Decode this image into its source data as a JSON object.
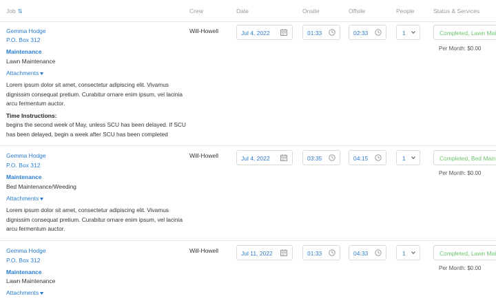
{
  "columns": {
    "job": "Job",
    "crew": "Crew",
    "date": "Date",
    "onsite": "Onsite",
    "offsite": "Offsite",
    "people": "People",
    "status": "Status & Services"
  },
  "icons": {
    "sort": "sort-icon",
    "calendar": "calendar-icon",
    "clock": "clock-icon",
    "chevron": "chevron-down-icon"
  },
  "rows": [
    {
      "customer": "Gemma Hodge",
      "address": "P.O. Box 312",
      "category": "Maintenance",
      "service": "Lawn Maintenance",
      "attachments": "Attachments",
      "description": "Lorem ipsum dolor sit amet, consectetur adipiscing elit. Vivamus dignissim consequat pretium. Curabitur ornare enim ipsum, vel lacinia arcu fermentum auctor.",
      "time_instructions_label": "Time Instructions:",
      "time_instructions": "begins the second week of May, unless SCU has been delayed. If SCU has been delayed, begin a week after SCU has been completed",
      "crew": "Will-Howell",
      "date": "Jul 4, 2022",
      "onsite": "01:33",
      "offsite": "02:33",
      "people": "1",
      "status": "Completed, Lawn Mai...",
      "per_month": "Per Month: $0.00"
    },
    {
      "customer": "Gemma Hodge",
      "address": "P.O. Box 312",
      "category": "Maintenance",
      "service": "Bed Maintenance/Weeding",
      "attachments": "Attachments",
      "description": "Lorem ipsum dolor sit amet, consectetur adipiscing elit. Vivamus dignissim consequat pretium. Curabitur ornare enim ipsum, vel lacinia arcu fermentum auctor.",
      "crew": "Will-Howell",
      "date": "Jul 4, 2022",
      "onsite": "03:35",
      "offsite": "04:15",
      "people": "1",
      "status": "Completed, Bed Main...",
      "per_month": "Per Month: $0.00"
    },
    {
      "customer": "Gemma Hodge",
      "address": "P.O. Box 312",
      "category": "Maintenance",
      "service": "Lawn Maintenance",
      "attachments": "Attachments",
      "crew": "Will-Howell",
      "date": "Jul 11, 2022",
      "onsite": "01:33",
      "offsite": "04:33",
      "people": "1",
      "status": "Completed, Lawn Mai...",
      "per_month": "Per Month: $0.00"
    }
  ]
}
